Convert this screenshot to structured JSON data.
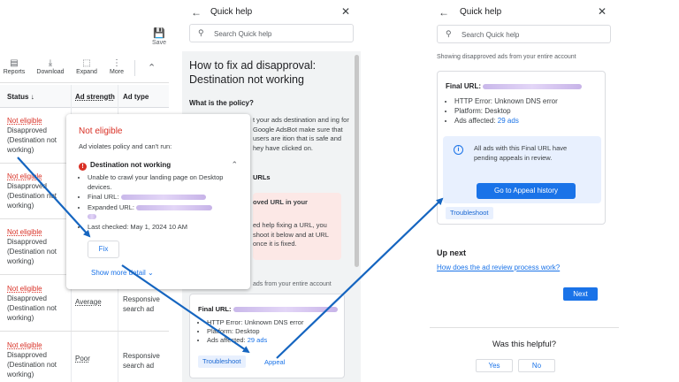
{
  "colors": {
    "accent": "#1a73e8",
    "error": "#d93025",
    "arrow": "#1565c0"
  },
  "table": {
    "save_label": "Save",
    "toolbar": [
      {
        "label": "Reports",
        "icon": "reports-icon"
      },
      {
        "label": "Download",
        "icon": "download-icon"
      },
      {
        "label": "Expand",
        "icon": "expand-icon"
      },
      {
        "label": "More",
        "icon": "more-icon"
      }
    ],
    "headers": {
      "status": "Status",
      "strength": "Ad strength",
      "type": "Ad type"
    },
    "rows": [
      {
        "status": "Not eligible",
        "reason": "Disapproved (Destination not working)",
        "strength": "",
        "type": ""
      },
      {
        "status": "Not eligible",
        "reason": "Disapproved (Destination not working)",
        "strength": "",
        "type": ""
      },
      {
        "status": "Not eligible",
        "reason": "Disapproved (Destination not working)",
        "strength": "",
        "type": ""
      },
      {
        "status": "Not eligible",
        "reason": "Disapproved (Destination not working)",
        "strength": "Average",
        "type": "Responsive search ad"
      },
      {
        "status": "Not eligible",
        "reason": "Disapproved (Destination not working)",
        "strength": "Poor",
        "type": "Responsive search ad"
      }
    ]
  },
  "popup": {
    "title": "Not eligible",
    "subtitle": "Ad violates policy and can't run:",
    "issue": "Destination not working",
    "bullets": {
      "crawl": "Unable to crawl your landing page on Desktop devices.",
      "final_url": "Final URL:",
      "expanded_url": "Expanded URL:",
      "last_checked": "Last checked: May 1, 2024 10 AM"
    },
    "fix_label": "Fix",
    "show_more": "Show more detail"
  },
  "quick_help": {
    "title": "Quick help",
    "search_placeholder": "Search Quick help",
    "article": {
      "title": "How to fix ad disapproval: Destination not working",
      "policy_heading": "What is the policy?",
      "policy_text": "t your ads destination and ing for Google AdsBot make sure that users are ition that is safe and hey have clicked on.",
      "urls_heading": "URLs",
      "red_title": "oved URL in your",
      "red_body": "ed help fixing a URL, you shoot it below and at URL once it is fixed.",
      "from_text": "ads from your entire account"
    },
    "url_card": {
      "final_url": "Final URL:",
      "http_error": "HTTP Error: Unknown DNS error",
      "platform": "Platform: Desktop",
      "affected_label": "Ads affected:",
      "affected_count": "29 ads",
      "troubleshoot": "Troubleshoot",
      "appeal": "Appeal"
    }
  },
  "appeal_panel": {
    "title": "Quick help",
    "search_placeholder": "Search Quick help",
    "from_text": "Showing disapproved ads from your entire account",
    "final_url": "Final URL:",
    "http_error": "HTTP Error: Unknown DNS error",
    "platform": "Platform: Desktop",
    "affected_label": "Ads affected:",
    "affected_count": "29 ads",
    "info_text": "All ads with this Final URL have pending appeals in review.",
    "appeal_history": "Go to Appeal history",
    "troubleshoot": "Troubleshoot",
    "up_next": "Up next",
    "review_link": "How does the ad review process work?",
    "next": "Next",
    "helpful": "Was this helpful?",
    "yes": "Yes",
    "no": "No"
  }
}
